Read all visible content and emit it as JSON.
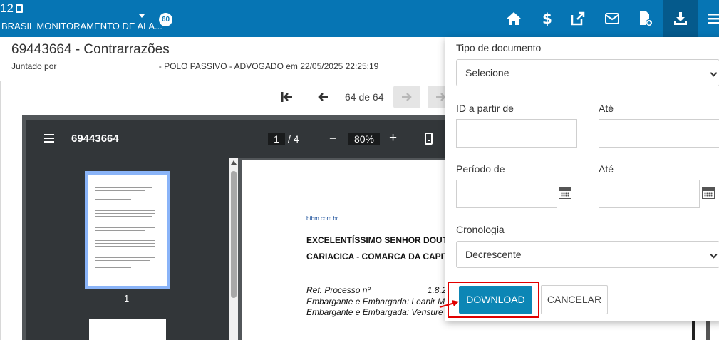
{
  "navbar": {
    "process_number": "12",
    "party_name": "BRASIL MONITORAMENTO DE ALA...",
    "badge": "60",
    "icons": [
      "home-icon",
      "dollar-icon",
      "external-link-icon",
      "mail-icon",
      "document-add-icon",
      "download-icon",
      "menu-icon"
    ]
  },
  "document": {
    "title": "69443664 - Contrarrazões",
    "subtitle": "Juntado por                                           - POLO PASSIVO - ADVOGADO em 22/05/2025 22:25:19"
  },
  "pagination": {
    "label": "64 de 64"
  },
  "viewer": {
    "file_name": "69443664",
    "current_page": "1",
    "total_pages": "/  4",
    "zoom": "80%",
    "zoom_out": "−",
    "zoom_in": "+",
    "thumbnail_label": "1",
    "page_text": {
      "link": "bfbm.com.br",
      "heading1": "EXCELENTÍSSIMO SENHOR DOUTOR",
      "heading2": "CARIACICA - COMARCA DA CAPITAL/",
      "ref": "Ref. Processo nº",
      "ref_tail": "1.8.2",
      "line2": "Embargante e Embargada: Leanir Ma",
      "line3": "Embargante e Embargada: Verisure B"
    }
  },
  "filter_panel": {
    "doc_type_label": "Tipo de documento",
    "doc_type_value": "Selecione",
    "id_from_label": "ID a partir de",
    "id_to_label": "Até",
    "period_from_label": "Período de",
    "period_to_label": "Até",
    "chronology_label": "Cronologia",
    "chronology_value": "Decrescente",
    "download_button": "DOWNLOAD",
    "cancel_button": "CANCELAR"
  },
  "colors": {
    "navbar": "#0675b4",
    "navbar_active": "#055a8c",
    "download_button": "#0c86b5",
    "highlight": "#e10000"
  }
}
